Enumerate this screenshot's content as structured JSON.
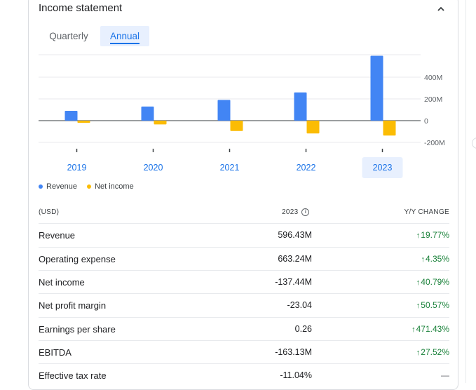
{
  "title": "Income statement",
  "tabs": {
    "quarterly": "Quarterly",
    "annual": "Annual",
    "active": "annual"
  },
  "chart_data": {
    "type": "bar",
    "categories": [
      "2019",
      "2020",
      "2021",
      "2022",
      "2023"
    ],
    "selected_category": "2023",
    "series": [
      {
        "name": "Revenue",
        "color": "#4285f4",
        "values": [
          90,
          130,
          190,
          260,
          596.43
        ]
      },
      {
        "name": "Net income",
        "color": "#fbbc04",
        "values": [
          -20,
          -35,
          -95,
          -118,
          -137.44
        ]
      }
    ],
    "ylim": [
      -250,
      650
    ],
    "y_ticks": [
      {
        "value": 400,
        "label": "400M"
      },
      {
        "value": 200,
        "label": "200M"
      },
      {
        "value": 0,
        "label": "0"
      },
      {
        "value": -200,
        "label": "-200M"
      }
    ],
    "grid": true,
    "legend": "bottom-left"
  },
  "table": {
    "header": {
      "currency": "(USD)",
      "year": "2023",
      "change": "Y/Y CHANGE"
    },
    "rows": [
      {
        "label": "Revenue",
        "value": "596.43M",
        "change": "19.77%",
        "arrow": "↑"
      },
      {
        "label": "Operating expense",
        "value": "663.24M",
        "change": "4.35%",
        "arrow": "↑"
      },
      {
        "label": "Net income",
        "value": "-137.44M",
        "change": "40.79%",
        "arrow": "↑"
      },
      {
        "label": "Net profit margin",
        "value": "-23.04",
        "change": "50.57%",
        "arrow": "↑"
      },
      {
        "label": "Earnings per share",
        "value": "0.26",
        "change": "471.43%",
        "arrow": "↑"
      },
      {
        "label": "EBITDA",
        "value": "-163.13M",
        "change": "27.52%",
        "arrow": "↑"
      },
      {
        "label": "Effective tax rate",
        "value": "-11.04%",
        "change": "—",
        "arrow": ""
      }
    ]
  }
}
